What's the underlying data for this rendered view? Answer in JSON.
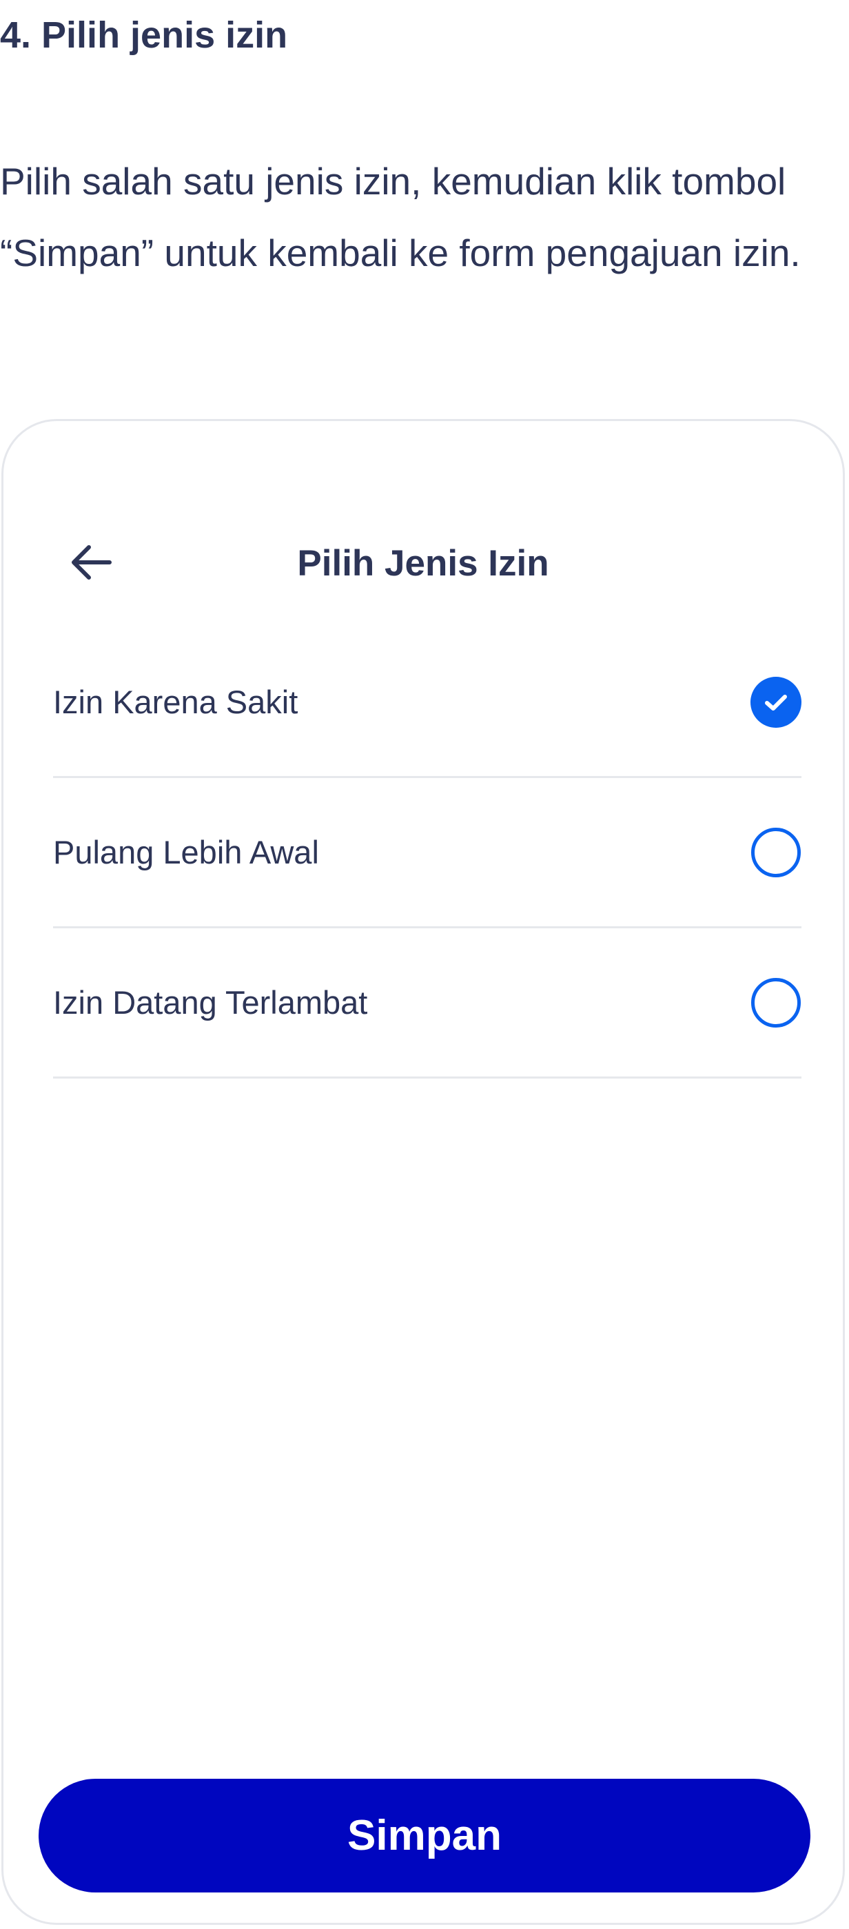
{
  "step": {
    "title": "4.  Pilih jenis izin",
    "description": "Pilih salah satu jenis izin, kemudian klik tombol “Simpan” untuk kembali ke form pengajuan izin."
  },
  "screen": {
    "back_icon": "arrow-left-icon",
    "title": "Pilih Jenis Izin",
    "options": [
      {
        "label": "Izin Karena Sakit",
        "selected": true
      },
      {
        "label": "Pulang Lebih Awal",
        "selected": false
      },
      {
        "label": "Izin Datang Terlambat",
        "selected": false
      }
    ],
    "save_label": "Simpan"
  },
  "colors": {
    "text": "#2d3557",
    "primary_button": "#0006bf",
    "radio_accent": "#0a63f0",
    "divider": "#e6e8ec",
    "frame_border": "#e5e7ec"
  }
}
